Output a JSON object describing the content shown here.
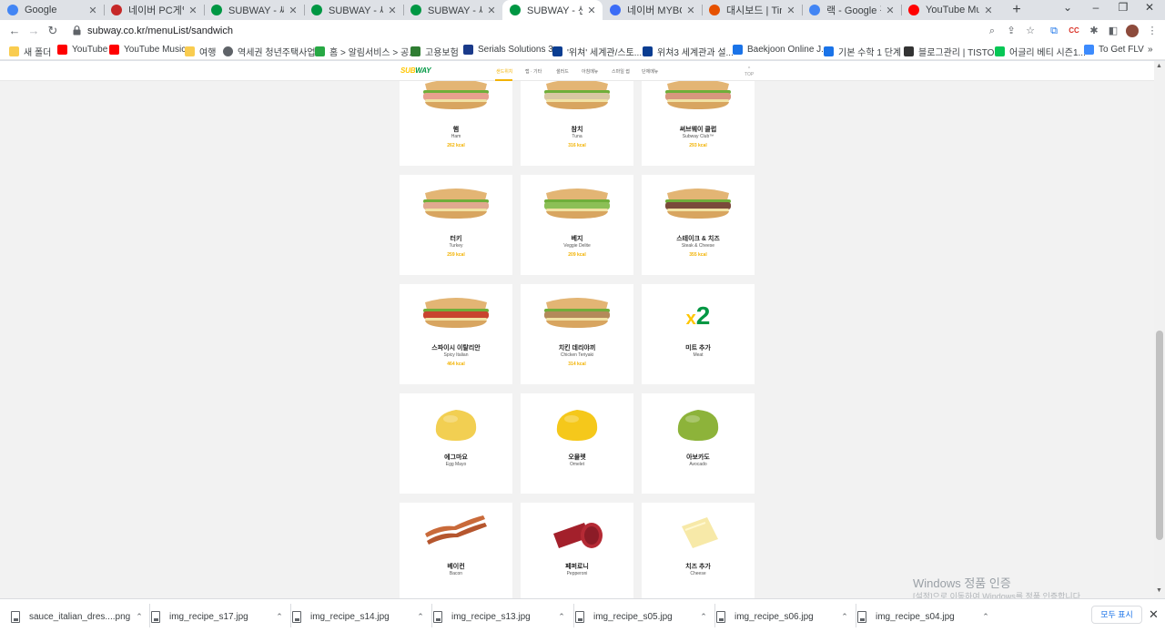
{
  "browser": {
    "tabs": [
      {
        "title": "Google",
        "icon": "google-icon",
        "color": "#4285f4",
        "active": false
      },
      {
        "title": "네이버 PC게임",
        "icon": "naver-game-icon",
        "color": "#c62828",
        "active": false
      },
      {
        "title": "SUBWAY - 써브웨",
        "icon": "subway-icon",
        "color": "#009743",
        "active": false
      },
      {
        "title": "SUBWAY - 써브웨",
        "icon": "subway-icon",
        "color": "#009743",
        "active": false
      },
      {
        "title": "SUBWAY - 써브웨",
        "icon": "subway-icon",
        "color": "#009743",
        "active": false
      },
      {
        "title": "SUBWAY - 샌드위",
        "icon": "subway-icon",
        "color": "#009743",
        "active": true
      },
      {
        "title": "네이버 MYBOX",
        "icon": "mybox-icon",
        "color": "#3b6cf6",
        "active": false
      },
      {
        "title": "대시보드 | Tinkerc",
        "icon": "tinkercad-icon",
        "color": "#e65100",
        "active": false
      },
      {
        "title": "랙 - Google 검색",
        "icon": "google-icon",
        "color": "#4285f4",
        "active": false
      },
      {
        "title": "YouTube Music",
        "icon": "youtube-music-icon",
        "color": "#ff0000",
        "active": false
      }
    ],
    "new_tab": "+",
    "url": "subway.co.kr/menuList/sandwich",
    "bookmarks": [
      {
        "label": "새 폴더",
        "icon": "folder-icon",
        "color": "#f9cc4f"
      },
      {
        "label": "YouTube",
        "icon": "youtube-icon",
        "color": "#ff0000"
      },
      {
        "label": "YouTube Music",
        "icon": "youtube-music-icon",
        "color": "#ff0000"
      },
      {
        "label": "여행",
        "icon": "folder-icon",
        "color": "#f9cc4f"
      },
      {
        "label": "역세권 청년주택사업",
        "icon": "globe-icon",
        "color": "#5f6368"
      },
      {
        "label": "홈 > 알림서비스 > 공...",
        "icon": "sh-icon",
        "color": "#27a844"
      },
      {
        "label": "고용보험",
        "icon": "employment-icon",
        "color": "#2f7d32"
      },
      {
        "label": "Serials Solutions 3...",
        "icon": "serials-icon",
        "color": "#1a3a8a"
      },
      {
        "label": "'위쳐' 세계관/스토...",
        "icon": "namu-icon",
        "color": "#0a3d91"
      },
      {
        "label": "위쳐3 세계관과 설...",
        "icon": "namu-icon",
        "color": "#0a3d91"
      },
      {
        "label": "Baekjoon Online J...",
        "icon": "code-icon",
        "color": "#1a73e8"
      },
      {
        "label": "기본 수학 1 단계",
        "icon": "code-icon",
        "color": "#1a73e8"
      },
      {
        "label": "블로그관리 | TISTO...",
        "icon": "tistory-icon",
        "color": "#333333"
      },
      {
        "label": "어글리 베티 시즌1...",
        "icon": "line-icon",
        "color": "#06c755"
      },
      {
        "label": "To Get FLV",
        "icon": "flv-icon",
        "color": "#3d8bfd"
      }
    ]
  },
  "site": {
    "logo_sub": "SUB",
    "logo_way": "WAY",
    "nav": [
      "샌드위치",
      "랩 · 기타",
      "샐러드",
      "아침메뉴",
      "스마일 썹",
      "단체메뉴"
    ],
    "top_label": "TOP",
    "menu": [
      {
        "name_ko": "햄",
        "name_en": "Ham",
        "kcal": "262 kcal",
        "kind": "sandwich",
        "img_color": "#e7a08e"
      },
      {
        "name_ko": "참치",
        "name_en": "Tuna",
        "kcal": "316 kcal",
        "kind": "sandwich",
        "img_color": "#d9c7a3"
      },
      {
        "name_ko": "써브웨이 클럽",
        "name_en": "Subway Club™",
        "kcal": "293 kcal",
        "kind": "sandwich",
        "img_color": "#d7977e"
      },
      {
        "name_ko": "터키",
        "name_en": "Turkey",
        "kcal": "259 kcal",
        "kind": "sandwich",
        "img_color": "#e0a98f"
      },
      {
        "name_ko": "베지",
        "name_en": "Veggie Delite",
        "kcal": "209 kcal",
        "kind": "sandwich",
        "img_color": "#8cbf56"
      },
      {
        "name_ko": "스테이크 & 치즈",
        "name_en": "Steak & Cheese",
        "kcal": "355 kcal",
        "kind": "sandwich",
        "img_color": "#7a4a3a"
      },
      {
        "name_ko": "스파이시 이탈리안",
        "name_en": "Spicy Italian",
        "kcal": "464 kcal",
        "kind": "sandwich",
        "img_color": "#c8442f"
      },
      {
        "name_ko": "치킨 데리야끼",
        "name_en": "Chicken Teriyaki",
        "kcal": "314 kcal",
        "kind": "sandwich",
        "img_color": "#b38a5a"
      },
      {
        "name_ko": "미트 추가",
        "name_en": "Meat",
        "kcal": "",
        "kind": "x2",
        "img_text": "x2",
        "img_color": "#009743"
      },
      {
        "name_ko": "에그마요",
        "name_en": "Egg Mayo",
        "kcal": "",
        "kind": "blob",
        "img_color": "#f2cf52"
      },
      {
        "name_ko": "오믈렛",
        "name_en": "Omelet",
        "kcal": "",
        "kind": "blob",
        "img_color": "#f5c81b"
      },
      {
        "name_ko": "아보카도",
        "name_en": "Avocado",
        "kcal": "",
        "kind": "blob",
        "img_color": "#8db33a"
      },
      {
        "name_ko": "베이컨",
        "name_en": "Bacon",
        "kcal": "",
        "kind": "bacon",
        "img_color": "#b5562e"
      },
      {
        "name_ko": "페퍼로니",
        "name_en": "Pepperoni",
        "kcal": "",
        "kind": "pepperoni",
        "img_color": "#a3202b"
      },
      {
        "name_ko": "치즈 추가",
        "name_en": "Cheese",
        "kcal": "",
        "kind": "cheese",
        "img_color": "#f7e9a8"
      }
    ]
  },
  "watermark": {
    "line1": "Windows 정품 인증",
    "line2": "[설정]으로 이동하여 Windows를 정품 인증합니다."
  },
  "downloads": {
    "items": [
      "sauce_italian_dres....png",
      "img_recipe_s17.jpg",
      "img_recipe_s14.jpg",
      "img_recipe_s13.jpg",
      "img_recipe_s05.jpg",
      "img_recipe_s06.jpg",
      "img_recipe_s04.jpg"
    ],
    "show_all": "모두 표시"
  }
}
